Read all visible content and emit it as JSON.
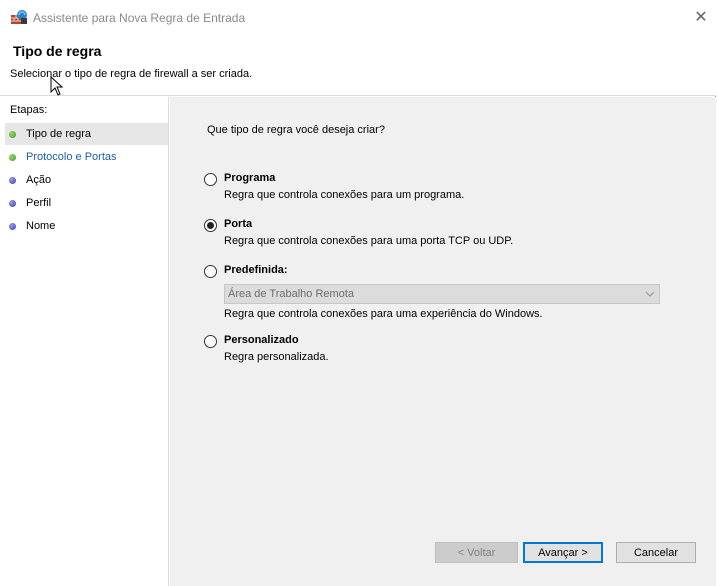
{
  "window": {
    "title": "Assistente para Nova Regra de Entrada",
    "close_symbol": "✕"
  },
  "header": {
    "title": "Tipo de regra",
    "subtitle": "Selecionar o tipo de regra de firewall a ser criada."
  },
  "steps": {
    "title": "Etapas:",
    "items": [
      {
        "label": "Tipo de regra",
        "status_color": "green",
        "current": true
      },
      {
        "label": "Protocolo e Portas",
        "status_color": "green",
        "current": false
      },
      {
        "label": "Ação",
        "status_color": "blue",
        "current": false
      },
      {
        "label": "Perfil",
        "status_color": "blue",
        "current": false
      },
      {
        "label": "Nome",
        "status_color": "blue",
        "current": false
      }
    ]
  },
  "content": {
    "question": "Que tipo de regra você deseja criar?",
    "options": [
      {
        "label": "Programa",
        "description": "Regra que controla conexões para um programa.",
        "selected": false
      },
      {
        "label": "Porta",
        "description": "Regra que controla conexões para uma porta TCP ou UDP.",
        "selected": true
      },
      {
        "label": "Predefinida:",
        "description": "Regra que controla conexões para uma experiência do Windows.",
        "selected": false
      },
      {
        "label": "Personalizado",
        "description": "Regra personalizada.",
        "selected": false
      }
    ],
    "predefined_select_value": "Área de Trabalho Remota"
  },
  "buttons": {
    "back": "< Voltar",
    "next": "Avançar >",
    "cancel": "Cancelar"
  },
  "colors": {
    "accent": "#0078d7",
    "link": "#1c5fa8",
    "step_done": "#3f9a22",
    "step_pending": "#3d3db0"
  }
}
